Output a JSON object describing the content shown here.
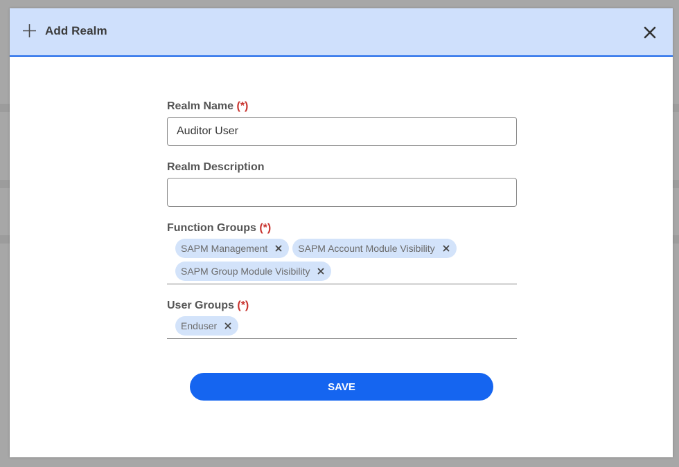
{
  "dialog": {
    "title": "Add Realm",
    "header_color": "#cfe0fc",
    "accent_color": "#1a66e8",
    "header_icon": "plus-icon",
    "close_icon": "close-icon"
  },
  "form": {
    "realm_name": {
      "label": "Realm Name",
      "required_marker": "(*)",
      "value": "Auditor User"
    },
    "realm_description": {
      "label": "Realm Description",
      "value": ""
    },
    "function_groups": {
      "label": "Function Groups",
      "required_marker": "(*)",
      "chips": [
        "SAPM Management",
        "SAPM Account Module Visibility",
        "SAPM Group Module Visibility"
      ],
      "chip_remove_icon": "close-icon"
    },
    "user_groups": {
      "label": "User Groups",
      "required_marker": "(*)",
      "chips": [
        "Enduser"
      ],
      "chip_remove_icon": "close-icon"
    },
    "required_color": "#c8322d"
  },
  "actions": {
    "save_label": "SAVE",
    "save_color": "#1565f0"
  }
}
